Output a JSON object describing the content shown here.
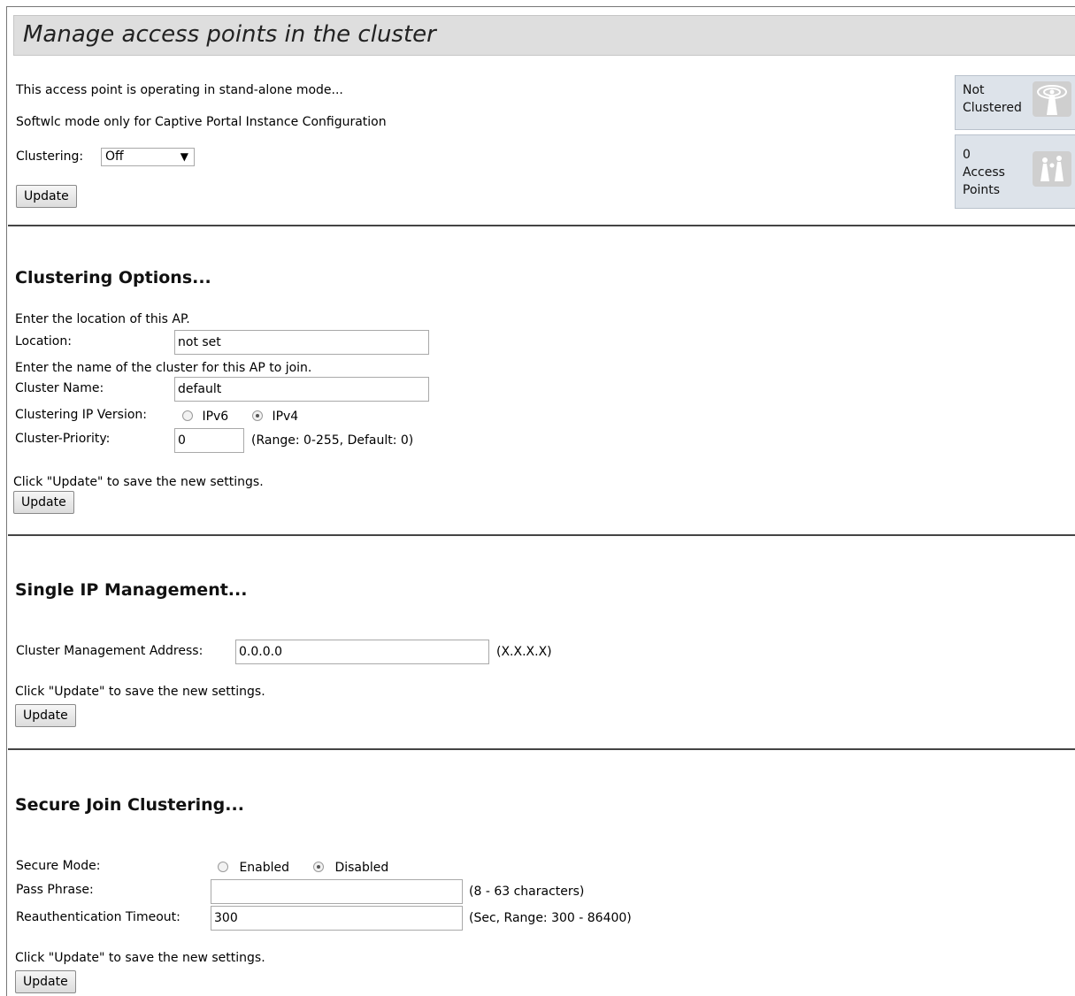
{
  "header": {
    "title": "Manage access points in the cluster"
  },
  "status": {
    "operating_mode": "This access point is operating in stand-alone mode...",
    "softwlc_note": "Softwlc mode only for Captive Portal Instance Configuration",
    "clustering_label": "Clustering:",
    "clustering_value": "Off",
    "update_label": "Update",
    "cluster_state_line1": "Not",
    "cluster_state_line2": "Clustered",
    "ap_count": "0",
    "ap_count_label1": "Access",
    "ap_count_label2": "Points"
  },
  "clustering_options": {
    "heading": "Clustering Options...",
    "location_hint": "Enter the location of this AP.",
    "location_label": "Location:",
    "location_value": "not set",
    "cluster_name_hint": "Enter the name of the cluster for this AP to join.",
    "cluster_name_label": "Cluster Name:",
    "cluster_name_value": "default",
    "ip_version_label": "Clustering IP Version:",
    "ipv6_label": "IPv6",
    "ipv4_label": "IPv4",
    "ip_version_selected": "IPv4",
    "priority_label": "Cluster-Priority:",
    "priority_value": "0",
    "priority_hint": "(Range: 0-255, Default: 0)",
    "save_hint": "Click \"Update\" to save the new settings.",
    "update_label": "Update"
  },
  "single_ip": {
    "heading": "Single IP Management...",
    "address_label": "Cluster Management Address:",
    "address_value": "0.0.0.0",
    "address_hint": "(X.X.X.X)",
    "save_hint": "Click \"Update\" to save the new settings.",
    "update_label": "Update"
  },
  "secure_join": {
    "heading": "Secure Join Clustering...",
    "secure_mode_label": "Secure Mode:",
    "enabled_label": "Enabled",
    "disabled_label": "Disabled",
    "secure_mode_selected": "Disabled",
    "pass_phrase_label": "Pass Phrase:",
    "pass_phrase_value": "",
    "pass_phrase_hint": "(8 - 63 characters)",
    "reauth_label": "Reauthentication Timeout:",
    "reauth_value": "300",
    "reauth_hint": "(Sec, Range: 300 - 86400)",
    "save_hint": "Click \"Update\" to save the new settings.",
    "update_label": "Update"
  }
}
